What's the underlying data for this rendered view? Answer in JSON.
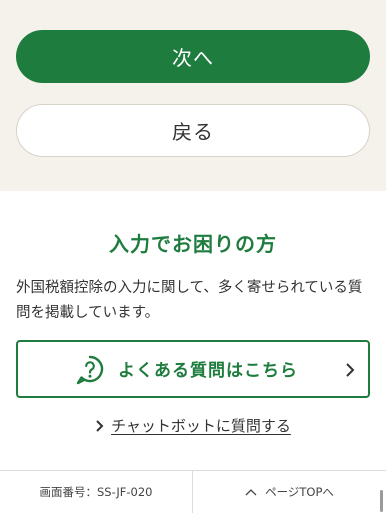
{
  "actions": {
    "next_label": "次へ",
    "back_label": "戻る"
  },
  "help": {
    "title": "入力でお困りの方",
    "description": "外国税額控除の入力に関して、多く寄せられている質問を掲載しています。",
    "faq_label": "よくある質問はこちら",
    "chatbot_label": "チャットボットに質問する"
  },
  "footer": {
    "screen_id": "画面番号：SS-JF-020",
    "page_top_label": "ページTOPへ"
  },
  "colors": {
    "brand_green": "#1e7c3e",
    "top_background": "#f5f2ec"
  },
  "icons": {
    "faq": "question-bubble-icon",
    "chevron": "chevron-right-icon",
    "page_top": "chevron-up-icon"
  }
}
